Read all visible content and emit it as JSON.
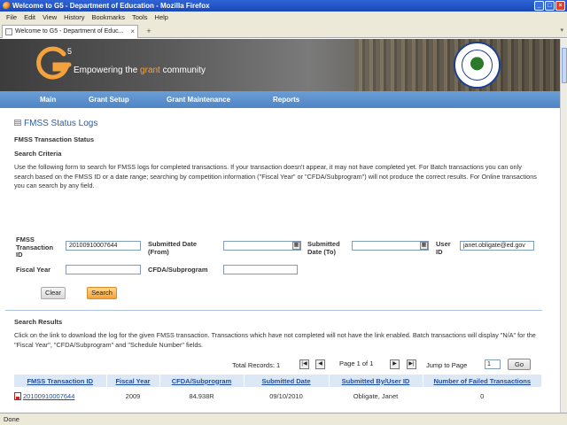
{
  "window": {
    "title": "Welcome to G5 - Department of Education - Mozilla Firefox"
  },
  "menu": [
    "File",
    "Edit",
    "View",
    "History",
    "Bookmarks",
    "Tools",
    "Help"
  ],
  "tabs": [
    {
      "label": "Welcome to G5 - Department of Educ..."
    }
  ],
  "new_tab": "+",
  "banner": {
    "logo_text": "G",
    "logo_sup": "5",
    "tagline_pre": "Empowering the ",
    "tagline_grant": "grant",
    "tagline_post": " community"
  },
  "nav": [
    "Main",
    "Grant Setup",
    "Grant Maintenance",
    "Reports"
  ],
  "page_title": "FMSS Status Logs",
  "section_transaction_status": "FMSS Transaction Status",
  "section_search_criteria": "Search Criteria",
  "instructions": "Use the following form to search for FMSS logs for completed transactions. If your transaction doesn't appear, it may not have completed yet. For Batch transactions you can only search based on the FMSS ID or a date range; searching by competition information (\"Fiscal Year\" or \"CFDA/Subprogram\") will not produce the correct results. For Online transactions you can search by any field.",
  "form": {
    "fmss_id_label": "FMSS Transaction ID",
    "fmss_id_value": "20100910007644",
    "submitted_from_label": "Submitted Date (From)",
    "submitted_from_value": "",
    "submitted_to_label": "Submitted Date (To)",
    "submitted_to_value": "",
    "user_id_label": "User ID",
    "user_id_value": "janet.obligate@ed.gov",
    "fiscal_year_label": "Fiscal Year",
    "fiscal_year_value": "",
    "cfda_label": "CFDA/Subprogram",
    "cfda_value": "",
    "clear_label": "Clear",
    "search_label": "Search"
  },
  "section_search_results": "Search Results",
  "results_note": "Click on the link to download the log for the given FMSS transaction. Transactions which have not completed will not have the link enabled. Batch transactions will display \"N/A\" for the \"Fiscal Year\", \"CFDA/Subprogram\" and \"Schedule Number\" fields.",
  "pager": {
    "total_records": "Total Records: 1",
    "page_info": "Page 1 of 1",
    "jump_label": "Jump to Page",
    "jump_value": "1",
    "go_label": "Go"
  },
  "table": {
    "headers": [
      "FMSS Transaction ID",
      "Fiscal Year",
      "CFDA/Subprogram",
      "Submitted Date",
      "Submitted By/User ID",
      "Number of Failed Transactions"
    ],
    "rows": [
      [
        "20100910007644",
        "2009",
        "84.938R",
        "09/10/2010",
        "Obligate, Janet",
        "0"
      ]
    ]
  },
  "status_bar": "Done",
  "colors": {
    "nav": "#5a8fcd",
    "accent": "#f6a23c",
    "link": "#1f4d9e"
  }
}
